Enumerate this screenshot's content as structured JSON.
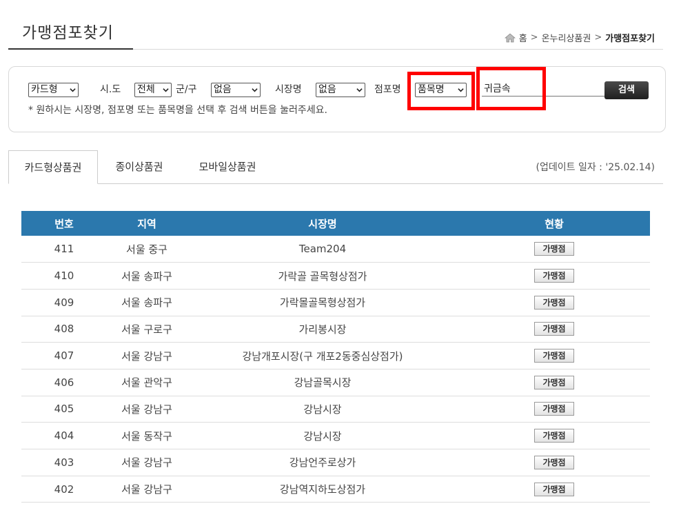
{
  "header": {
    "title": "가맹점포찾기",
    "breadcrumb": {
      "home": "홈",
      "sep": ">",
      "parent": "온누리상품권",
      "current": "가맹점포찾기"
    }
  },
  "search": {
    "type_select": "카드형",
    "sido_label": "시.도",
    "sido_select": "전체",
    "gungu_label": "군/구",
    "gungu_select": "없음",
    "market_label": "시장명",
    "market_select": "없음",
    "store_label": "점포명",
    "store_type_select": "품목명",
    "keyword_value": "귀금속",
    "button_label": "검색",
    "hint": "* 원하시는 시장명, 점포명 또는 품목명을 선택 후 검색 버튼을 눌러주세요."
  },
  "tabs": [
    "카드형상품권",
    "종이상품권",
    "모바일상품권"
  ],
  "update_text": "(업데이트 일자 : '25.02.14)",
  "table": {
    "headers": [
      "번호",
      "지역",
      "시장명",
      "현황"
    ],
    "button_label": "가맹점",
    "rows": [
      {
        "no": "411",
        "region": "서울 중구",
        "market": "Team204"
      },
      {
        "no": "410",
        "region": "서울 송파구",
        "market": "가락골 골목형상점가"
      },
      {
        "no": "409",
        "region": "서울 송파구",
        "market": "가락몰골목형상점가"
      },
      {
        "no": "408",
        "region": "서울 구로구",
        "market": "가리봉시장"
      },
      {
        "no": "407",
        "region": "서울 강남구",
        "market": "강남개포시장(구 개포2동중심상점가)"
      },
      {
        "no": "406",
        "region": "서울 관악구",
        "market": "강남골목시장"
      },
      {
        "no": "405",
        "region": "서울 강남구",
        "market": "강남시장"
      },
      {
        "no": "404",
        "region": "서울 동작구",
        "market": "강남시장"
      },
      {
        "no": "403",
        "region": "서울 강남구",
        "market": "강남언주로상가"
      },
      {
        "no": "402",
        "region": "서울 강남구",
        "market": "강남역지하도상점가"
      }
    ]
  },
  "colors": {
    "header_bg": "#2b78ad",
    "highlight": "#ff0000",
    "button_dark": "#2a2a2a"
  }
}
